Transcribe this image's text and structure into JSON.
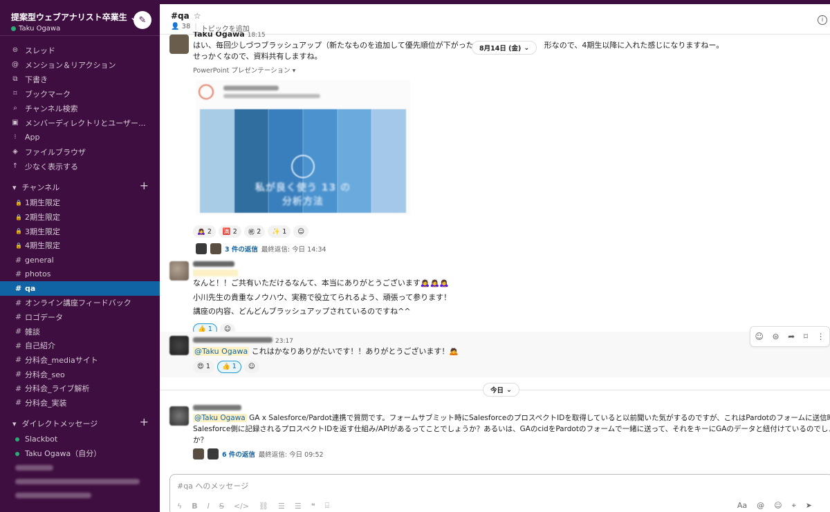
{
  "workspace": {
    "name": "提案型ウェブアナリスト卒業生",
    "user": "Taku Ogawa"
  },
  "nav": [
    {
      "icon": "threads-icon",
      "glyph": "⊜",
      "label": "スレッド"
    },
    {
      "icon": "mention-icon",
      "glyph": "@",
      "label": "メンション＆リアクション"
    },
    {
      "icon": "drafts-icon",
      "glyph": "⧉",
      "label": "下書き"
    },
    {
      "icon": "bookmark-icon",
      "glyph": "⌑",
      "label": "ブックマーク"
    },
    {
      "icon": "channel-search-icon",
      "glyph": "⌕",
      "label": "チャンネル検索"
    },
    {
      "icon": "member-directory-icon",
      "glyph": "▣",
      "label": "メンバーディレクトリとユーザー..."
    },
    {
      "icon": "apps-icon",
      "glyph": "⁝",
      "label": "App"
    },
    {
      "icon": "file-browser-icon",
      "glyph": "◈",
      "label": "ファイルブラウザ"
    },
    {
      "icon": "show-less-icon",
      "glyph": "↑",
      "label": "少なく表示する"
    }
  ],
  "channels_section": "チャンネル",
  "channels": [
    {
      "prefix": "🔒",
      "label": "1期生限定",
      "active": false
    },
    {
      "prefix": "🔒",
      "label": "2期生限定",
      "active": false
    },
    {
      "prefix": "🔒",
      "label": "3期生限定",
      "active": false
    },
    {
      "prefix": "🔒",
      "label": "4期生限定",
      "active": false
    },
    {
      "prefix": "#",
      "label": "general",
      "active": false
    },
    {
      "prefix": "#",
      "label": "photos",
      "active": false
    },
    {
      "prefix": "#",
      "label": "qa",
      "active": true
    },
    {
      "prefix": "#",
      "label": "オンライン講座フィードバック",
      "active": false
    },
    {
      "prefix": "#",
      "label": "ロゴデータ",
      "active": false
    },
    {
      "prefix": "#",
      "label": "雑談",
      "active": false
    },
    {
      "prefix": "#",
      "label": "自己紹介",
      "active": false
    },
    {
      "prefix": "#",
      "label": "分科会_mediaサイト",
      "active": false
    },
    {
      "prefix": "#",
      "label": "分科会_seo",
      "active": false
    },
    {
      "prefix": "#",
      "label": "分科会_ライブ解析",
      "active": false
    },
    {
      "prefix": "#",
      "label": "分科会_実装",
      "active": false
    }
  ],
  "dm_section": "ダイレクトメッセージ",
  "dms": [
    {
      "label": "Slackbot"
    },
    {
      "label": "Taku Ogawa（自分）"
    }
  ],
  "channel": {
    "name": "#qa",
    "members": "38",
    "topic": "トピックを追加"
  },
  "messages": {
    "m1": {
      "author": "Taku Ogawa",
      "time": "18:15",
      "line1": "はい、毎回少しづつブラッシュアップ（新たなものを追加して優先順位が下がったもの",
      "line1b": "形なので、4期生以降に入れた感じになりますねー。",
      "line2": "せっかくなので、資料共有しますね。",
      "attachment": "PowerPoint プレゼンテーション ▾",
      "reactions": [
        {
          "emoji": "🙇‍♀️",
          "count": "2"
        },
        {
          "emoji": "🈵",
          "count": "2"
        },
        {
          "emoji": "㊗",
          "count": "2"
        },
        {
          "emoji": "✨",
          "count": "1"
        }
      ],
      "thread_link": "3 件の返信",
      "thread_meta": "最終返信: 今日 14:34"
    },
    "m2": {
      "line1": "なんと！！ご共有いただけるなんて、本当にありがとうございます🙇‍♀️🙇‍♀️🙇‍♀️",
      "line2": "小川先生の貴重なノウハウ、実務で役立てられるよう、頑張って参ります！",
      "line3": "講座の内容、どんどんブラッシュアップされているのですね^^",
      "reaction": {
        "emoji": "👍",
        "count": "1"
      }
    },
    "m3": {
      "time": "23:17",
      "mention": "@Taku Ogawa",
      "text": " これはかなりありがたいです！！ありがとうございます！🙇",
      "reactions": [
        {
          "emoji": "😍",
          "count": "1"
        },
        {
          "emoji": "👍",
          "count": "1"
        }
      ]
    },
    "m4": {
      "mention": "@Taku Ogawa",
      "line1": " GA x Salesforce/Pardot連携で質問です。フォームサブミット時にSalesforceのプロスペクトIDを取得していると以前聞いた気がするのですが、これはPardotのフォームに送信時に",
      "line2": "Salesforce側に記録されるプロスペクトIDを返す仕組み/APIがあるってことでしょうか？あるいは、GAのcidをPardotのフォームで一緒に送って、それをキーにGAのデータと紐付けているのでしょう",
      "line3": "か？",
      "thread_link": "6 件の返信",
      "thread_meta": "最終返信: 今日 09:52"
    }
  },
  "date_pill_top": "8月14日 (金)",
  "date_pill_today": "今日",
  "slide_caption": "私が良く使う 13 の分析方法",
  "composer": {
    "placeholder": "#qa へのメッセージ"
  },
  "colors": {
    "sidebar": "#3f0e40",
    "active": "#1164a3",
    "link": "#1264a3",
    "mention_bg": "#fcf0c5"
  }
}
